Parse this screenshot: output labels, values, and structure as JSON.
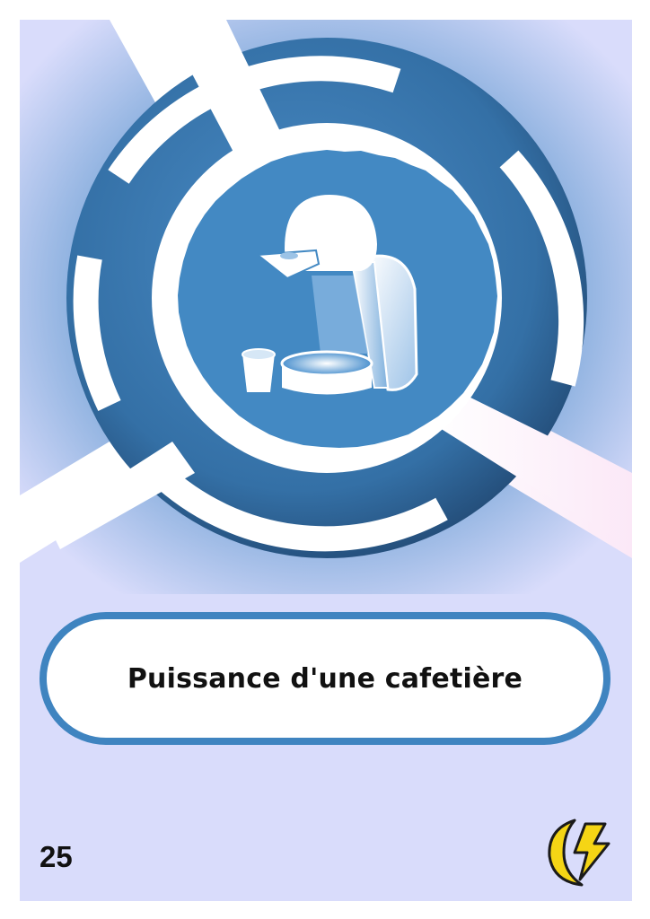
{
  "card": {
    "title": "Puissance d'une cafetière",
    "number": "25",
    "illustration_icon": "coffee-machine-icon",
    "logo_icon": "lightning-moon-icon",
    "colors": {
      "background": "#d9dcfb",
      "ring": "#3f84c0",
      "ring_dark": "#2b5f8e",
      "accent_yellow": "#f5d515"
    }
  }
}
